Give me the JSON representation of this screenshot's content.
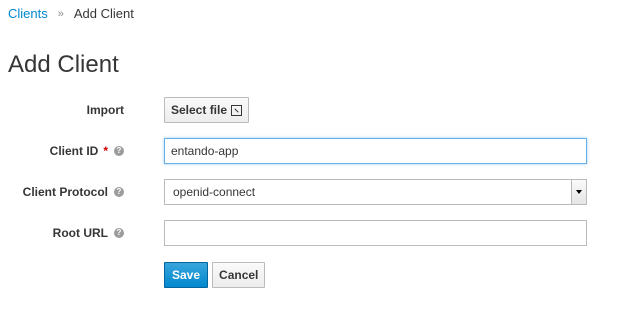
{
  "breadcrumb": {
    "parent": "Clients",
    "separator": "»",
    "current": "Add Client"
  },
  "page": {
    "title": "Add Client"
  },
  "form": {
    "import": {
      "label": "Import",
      "button_label": "Select file"
    },
    "client_id": {
      "label": "Client ID",
      "required_mark": "*",
      "value": "entando-app",
      "help_icon": "?"
    },
    "client_protocol": {
      "label": "Client Protocol",
      "value": "openid-connect",
      "help_icon": "?"
    },
    "root_url": {
      "label": "Root URL",
      "value": "",
      "help_icon": "?"
    }
  },
  "actions": {
    "save": "Save",
    "cancel": "Cancel"
  },
  "colors": {
    "link": "#0088ce",
    "primary": "#0088ce",
    "required": "#cc0000"
  }
}
